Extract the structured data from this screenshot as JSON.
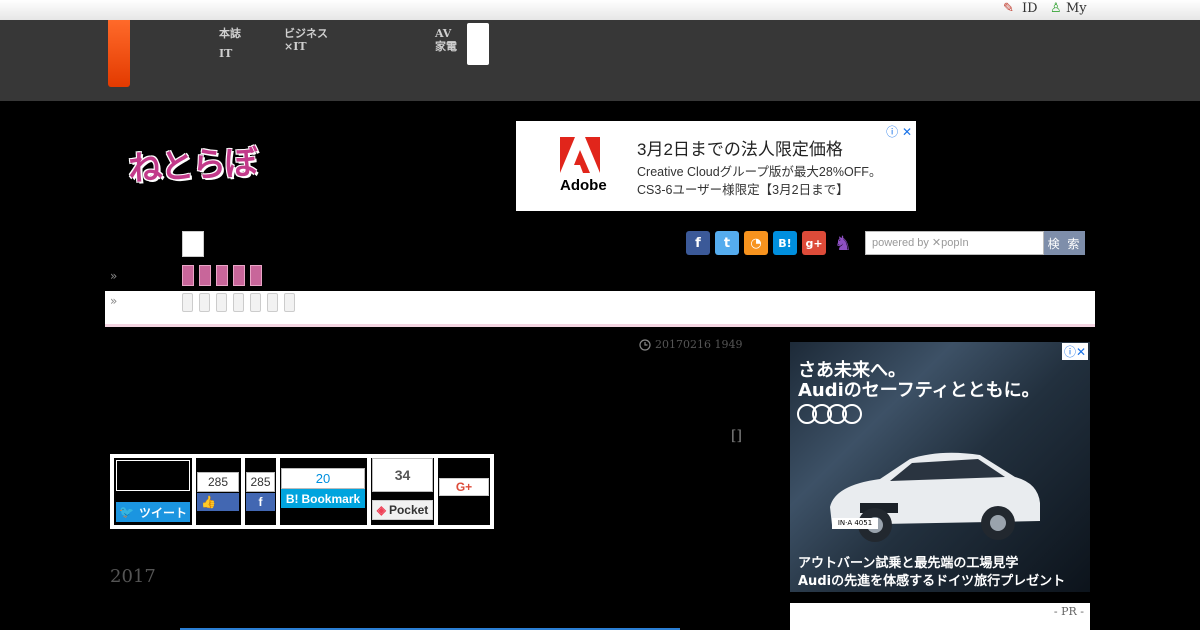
{
  "topbar": {
    "id_link": "ID",
    "my_link": "My"
  },
  "header_nav": {
    "item1_line1": "本誌",
    "item1_line2": "IT",
    "item2_line1": "ビジネス",
    "item2_line2": "×IT",
    "item3_line1": "AV",
    "item3_line2": "家電"
  },
  "logo": {
    "text": "ねとらぼ"
  },
  "adobe_ad": {
    "brand": "Adobe",
    "title": "3月2日までの法人限定価格",
    "line1": "Creative Cloudグループ版が最大28%OFF。",
    "line2": "CS3-6ユーザー様限定【3月2日まで】",
    "icons": "ⓘ ✕"
  },
  "nav": {
    "raquo1": "»",
    "raquo2": "»"
  },
  "social": {
    "colors": {
      "facebook": "#3b5998",
      "twitter": "#55acee",
      "rss": "#f7931e",
      "hatena": "#008fde",
      "gplus": "#dd4b39",
      "cat": "#8e4fc3"
    }
  },
  "search": {
    "placeholder": "powered by ✕popIn",
    "button": "検 索"
  },
  "article": {
    "date": "20170216 1949",
    "bracket": "[]",
    "year": "2017"
  },
  "share": {
    "tweet_label": "ツイート",
    "like_count": "285",
    "fb_share_count": "285",
    "bookmark_count": "20",
    "bookmark_label": "Bookmark",
    "pocket_count": "34",
    "pocket_label": "Pocket",
    "gplus_label": "G+"
  },
  "audi_ad": {
    "headline1": "さあ未来へ。",
    "headline2": "Audiのセーフティとともに。",
    "plate": "IN·A 4051",
    "bottom1": "アウトバーン試乗と最先端の工場見学",
    "bottom2": "Audiの先進を体感するドイツ旅行プレゼント",
    "icons": "ⓘ✕"
  },
  "pr_label": "- PR -"
}
